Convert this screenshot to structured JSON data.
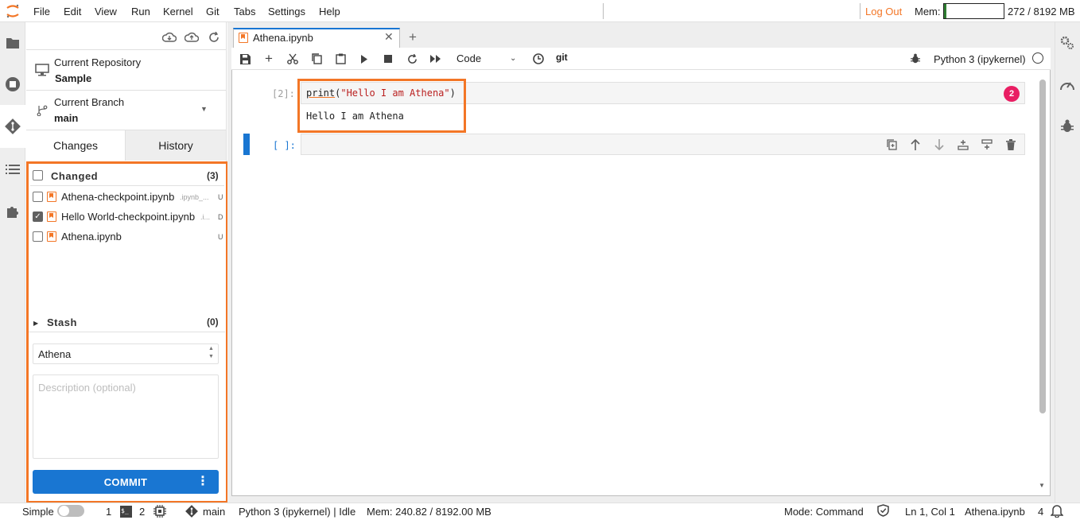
{
  "menu": {
    "items": [
      "File",
      "Edit",
      "View",
      "Run",
      "Kernel",
      "Git",
      "Tabs",
      "Settings",
      "Help"
    ],
    "logout": "Log Out",
    "mem_label": "Mem:",
    "mem_value": "272 / 8192 MB",
    "mem_fraction": 0.033
  },
  "left_sidebar": {
    "icons": [
      "folder-icon",
      "running-icon",
      "git-icon",
      "toc-icon",
      "extension-icon"
    ],
    "active": "git-icon"
  },
  "right_sidebar": {
    "icons": [
      "property-inspector-icon",
      "debugger-gauge-icon",
      "bug-icon"
    ]
  },
  "git_panel": {
    "toolbar_icons": [
      "cloud-pull-icon",
      "cloud-push-icon",
      "refresh-icon"
    ],
    "repository": {
      "label": "Current Repository",
      "name": "Sample"
    },
    "branch": {
      "label": "Current Branch",
      "name": "main"
    },
    "tabs": {
      "changes": "Changes",
      "history": "History",
      "active": "changes"
    },
    "changed": {
      "label": "Changed",
      "count": "(3)",
      "files": [
        {
          "name": "Athena-checkpoint.ipynb",
          "dir": ".ipynb_...",
          "status": "U",
          "checked": false
        },
        {
          "name": "Hello World-checkpoint.ipynb",
          "dir": ".i...",
          "status": "D",
          "checked": true
        },
        {
          "name": "Athena.ipynb",
          "dir": "",
          "status": "U",
          "checked": false
        }
      ]
    },
    "stash": {
      "label": "Stash",
      "count": "(0)"
    },
    "summary_value": "Athena",
    "description_placeholder": "Description (optional)",
    "commit_label": "COMMIT"
  },
  "notebook": {
    "tab_name": "Athena.ipynb",
    "toolbar": {
      "icons": [
        "save-icon",
        "add-cell-icon",
        "cut-icon",
        "copy-icon",
        "paste-icon",
        "run-icon",
        "stop-icon",
        "restart-icon",
        "fast-forward-icon"
      ],
      "cell_type": "Code",
      "git_label": "git",
      "kernel": "Python 3 (ipykernel)"
    },
    "cells": [
      {
        "prompt": "[2]:",
        "code_fn": "print",
        "code_open": "(",
        "code_str": "\"Hello I am Athena\"",
        "code_close": ")",
        "output": "Hello I am Athena",
        "error_badge": "2"
      },
      {
        "prompt": "[ ]:",
        "code": ""
      }
    ]
  },
  "status_bar": {
    "simple_label": "Simple",
    "terminals": "1",
    "kernels": "2",
    "branch": "main",
    "kernel_status": "Python 3 (ipykernel) | Idle",
    "mem": "Mem: 240.82 / 8192.00 MB",
    "mode": "Mode: Command",
    "position": "Ln 1, Col 1",
    "file": "Athena.ipynb",
    "notifications": "4"
  },
  "colors": {
    "accent": "#1976d2",
    "highlight": "#f37626",
    "error": "#e91e63"
  }
}
